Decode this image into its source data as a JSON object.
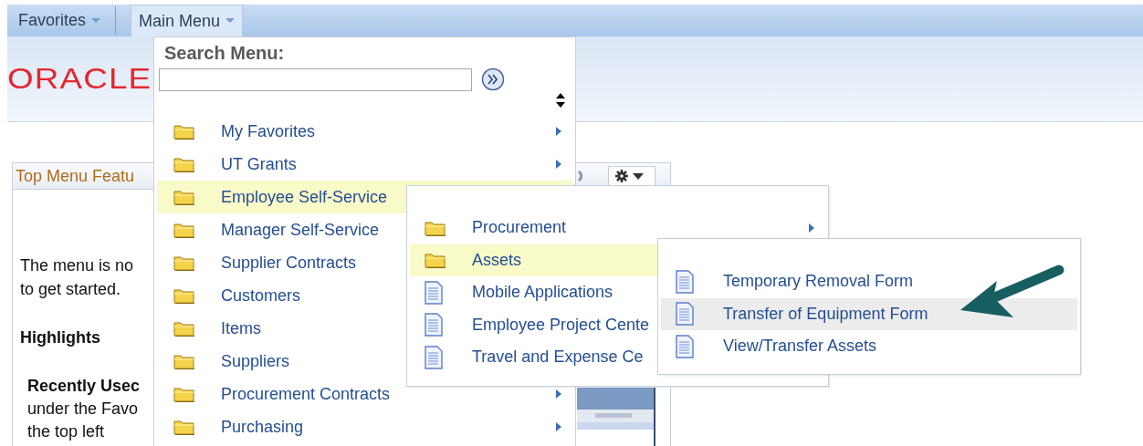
{
  "nav": {
    "tabs": [
      {
        "label": "Favorites",
        "selected": false
      },
      {
        "label": "Main Menu",
        "selected": true
      }
    ]
  },
  "banner": {
    "logo": "ORACLE"
  },
  "portlet": {
    "title": "Top Menu Featu",
    "blocks": [
      {
        "kind": "text",
        "lines": [
          "The menu is no",
          "to get started."
        ]
      },
      {
        "kind": "heading",
        "lines": [
          "Highlights"
        ]
      },
      {
        "kind": "subsection",
        "lines": [
          "Recently Usec",
          "under the Favo",
          "the top left"
        ]
      }
    ]
  },
  "main_menu": {
    "search_label": "Search Menu:",
    "items": [
      {
        "label": "My Favorites",
        "kind": "folder",
        "selected": false,
        "has_submenu": true
      },
      {
        "label": "UT Grants",
        "kind": "folder",
        "selected": false,
        "has_submenu": true
      },
      {
        "label": "Employee Self-Service",
        "kind": "folder",
        "selected": true
      },
      {
        "label": "Manager Self-Service",
        "kind": "folder",
        "selected": false
      },
      {
        "label": "Supplier Contracts",
        "kind": "folder",
        "selected": false
      },
      {
        "label": "Customers",
        "kind": "folder",
        "selected": false
      },
      {
        "label": "Items",
        "kind": "folder",
        "selected": false
      },
      {
        "label": "Suppliers",
        "kind": "folder",
        "selected": false
      },
      {
        "label": "Procurement Contracts",
        "kind": "folder",
        "selected": false,
        "has_submenu": true
      },
      {
        "label": "Purchasing",
        "kind": "folder",
        "selected": false,
        "has_submenu": true
      }
    ]
  },
  "submenu": {
    "items": [
      {
        "label": "Procurement",
        "kind": "folder",
        "selected": false,
        "has_submenu": true
      },
      {
        "label": "Assets",
        "kind": "folder",
        "selected": true
      },
      {
        "label": "Mobile Applications",
        "kind": "page",
        "selected": false
      },
      {
        "label": "Employee Project Cente",
        "kind": "page",
        "selected": false
      },
      {
        "label": "Travel and Expense Ce",
        "kind": "page",
        "selected": false
      }
    ]
  },
  "submenu_2": {
    "items": [
      {
        "label": "Temporary Removal Form",
        "kind": "page",
        "selected": false
      },
      {
        "label": "Transfer of Equipment Form",
        "kind": "page",
        "selected": true
      },
      {
        "label": "View/Transfer Assets",
        "kind": "page",
        "selected": false
      }
    ]
  }
}
